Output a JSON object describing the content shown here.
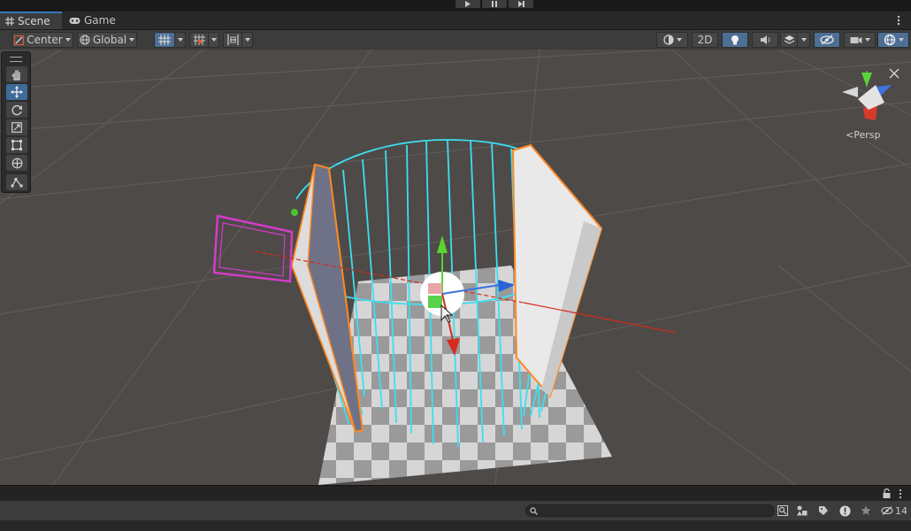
{
  "playbar": {
    "buttons": [
      "play-icon",
      "pause-icon",
      "step-icon"
    ]
  },
  "tabs": [
    {
      "label": "Scene",
      "icon": "grid-icon",
      "active": true
    },
    {
      "label": "Game",
      "icon": "gamepad-icon",
      "active": false
    }
  ],
  "toolbar": {
    "pivot_label": "Center",
    "space_label": "Global",
    "mode_2d_label": "2D"
  },
  "tools": [
    "hand-icon",
    "move-icon",
    "rotate-icon",
    "scale-icon",
    "rect-icon",
    "transform-icon",
    "custom-tool-icon"
  ],
  "gizmo": {
    "projection_label": "Persp"
  },
  "status": {
    "hidden_count": "14"
  },
  "colors": {
    "accent": "#3a79bb",
    "selection": "#ff8a24",
    "wireframe": "#3cdff0",
    "camera": "#d43cc8"
  }
}
